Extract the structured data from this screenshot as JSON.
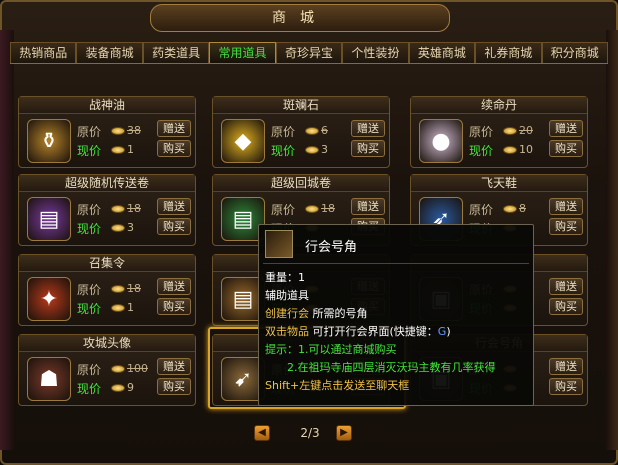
{
  "window": {
    "title": "商城",
    "close_glyph": "✕"
  },
  "tabs": [
    "热销商品",
    "装备商城",
    "药类道具",
    "常用道具",
    "奇珍异宝",
    "个性装扮",
    "英雄商城",
    "礼券商城",
    "积分商城"
  ],
  "active_tab": "常用道具",
  "labels": {
    "original_price": "原价",
    "current_price": "现价",
    "gift": "赠送",
    "buy": "购买"
  },
  "items": [
    {
      "name": "战神油",
      "orig": "38",
      "now": "1",
      "icon": "flask-icon",
      "color": "#b8842a"
    },
    {
      "name": "斑斓石",
      "orig": "6",
      "now": "3",
      "icon": "gem-icon",
      "color": "#e0b020"
    },
    {
      "name": "续命丹",
      "orig": "20",
      "now": "10",
      "icon": "pill-icon",
      "color": "#cfb9cf"
    },
    {
      "name": "超级随机传送卷",
      "orig": "18",
      "now": "3",
      "icon": "scroll-icon",
      "color": "#7a3aa0"
    },
    {
      "name": "超级回城卷",
      "orig": "18",
      "now": "",
      "icon": "scroll-icon",
      "color": "#2e8a3a"
    },
    {
      "name": "飞天鞋",
      "orig": "8",
      "now": "",
      "icon": "boot-icon",
      "color": "#2a5aa0"
    },
    {
      "name": "召集令",
      "orig": "18",
      "now": "1",
      "icon": "token-icon",
      "color": "#b83a1a"
    },
    {
      "name": "",
      "orig": "",
      "now": "",
      "icon": "scroll-icon",
      "color": "#9a6a2a"
    },
    {
      "name": "",
      "orig": "",
      "now": "",
      "icon": "item-icon",
      "color": "#5a4a3a"
    },
    {
      "name": "攻城头像",
      "orig": "100",
      "now": "9",
      "icon": "avatar-icon",
      "color": "#7a3a2a"
    },
    {
      "name": "",
      "orig": "",
      "now": "",
      "icon": "horn-icon",
      "color": "#8a6a3a"
    },
    {
      "name": "行会号角",
      "orig": "",
      "now": "",
      "icon": "item-icon",
      "color": "#5a4a3a"
    }
  ],
  "tooltip": {
    "title": "行会号角",
    "weight": "重量：1",
    "category": "辅助道具",
    "desc_label": "创建行会",
    "desc_text": "所需的号角",
    "dbl_label": "双击物品",
    "dbl_text": "可打开行会界面(快捷键：",
    "dbl_key": "G",
    "dbl_end": ")",
    "tip1": "提示：1.可以通过商城购买",
    "tip2": "2.在祖玛寺庙四层消灭沃玛主教有几率获得",
    "shift": "Shift+左键点击发送至聊天框"
  },
  "pager": {
    "page": "2/3"
  },
  "colors": {
    "accent_green": "#42e63c",
    "gold_border": "#d9a526",
    "tooltip_blue": "#5aa0ff"
  }
}
